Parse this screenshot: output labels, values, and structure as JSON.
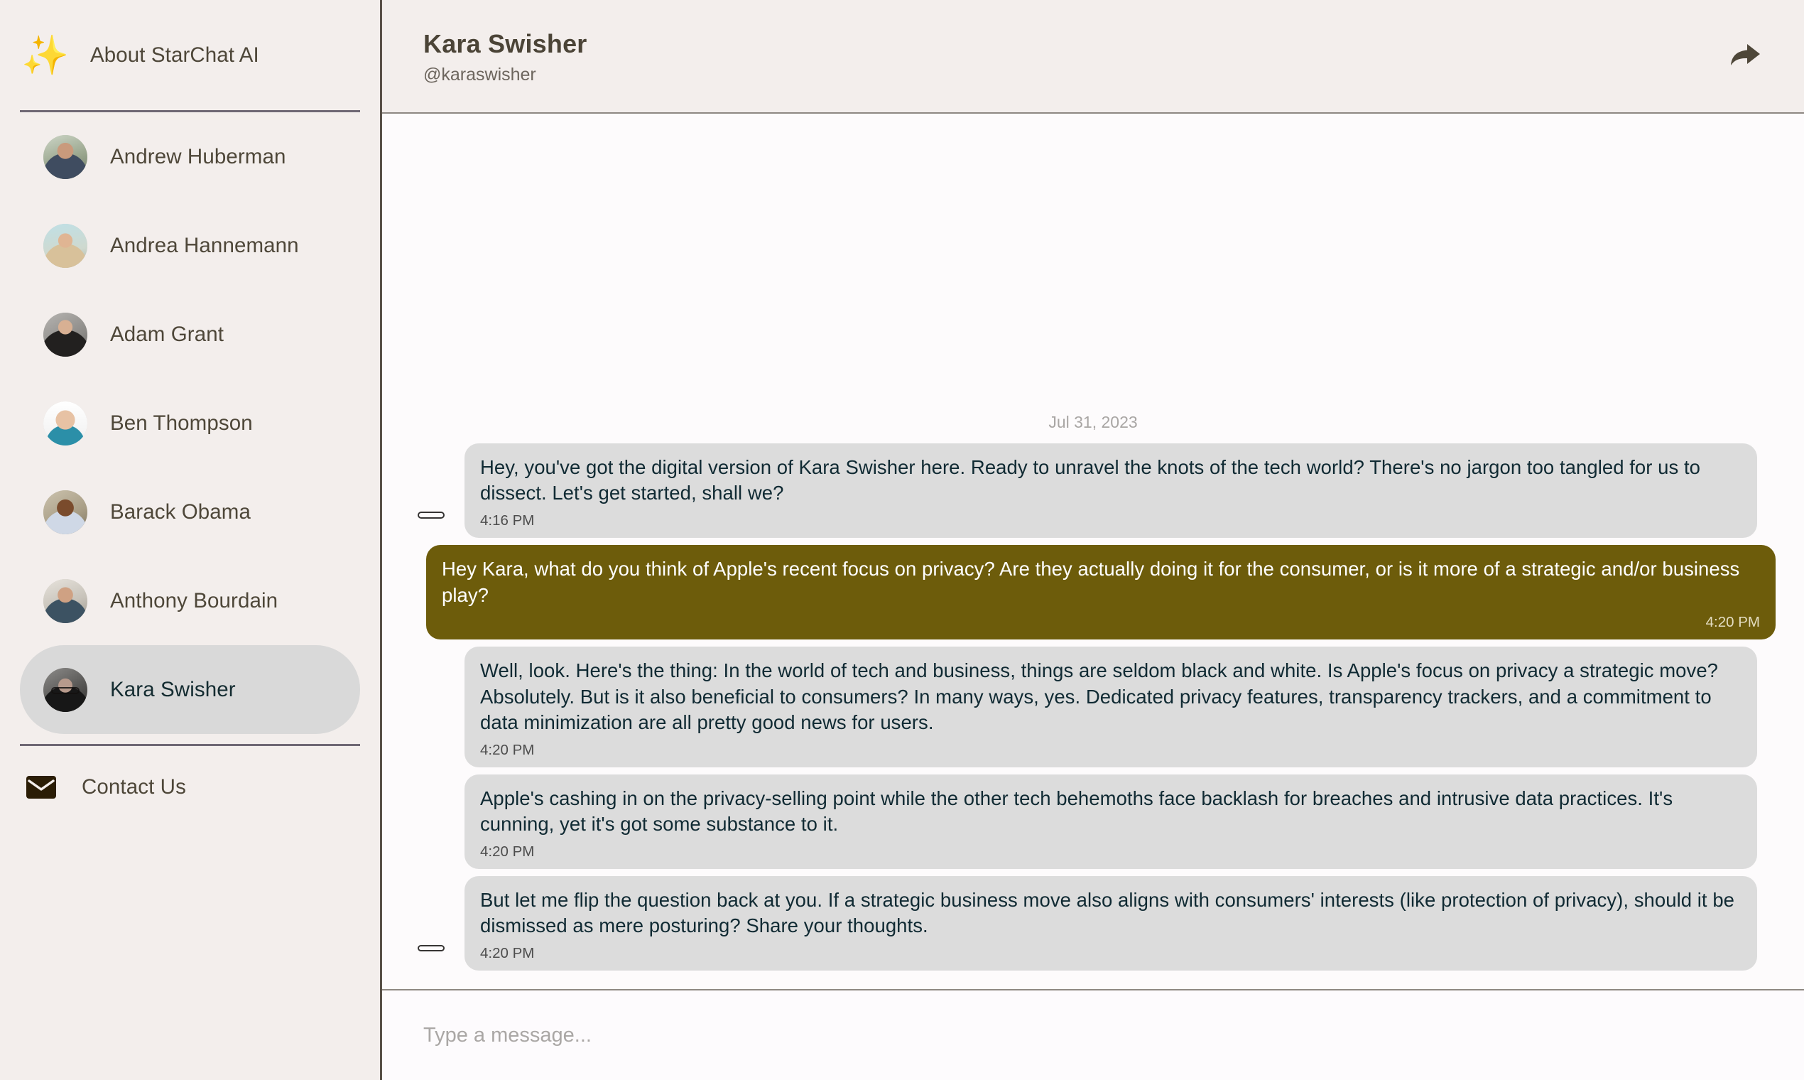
{
  "sidebar": {
    "about": {
      "label": "About StarChat AI",
      "icon": "sparkles-icon"
    },
    "people": [
      {
        "name": "Andrew Huberman",
        "avatar": "av-huberman",
        "selected": false
      },
      {
        "name": "Andrea Hannemann",
        "avatar": "av-hannemann",
        "selected": false
      },
      {
        "name": "Adam Grant",
        "avatar": "av-grant",
        "selected": false
      },
      {
        "name": "Ben Thompson",
        "avatar": "av-thompson",
        "selected": false
      },
      {
        "name": "Barack Obama",
        "avatar": "av-obama",
        "selected": false
      },
      {
        "name": "Anthony Bourdain",
        "avatar": "av-bourdain",
        "selected": false
      },
      {
        "name": "Kara Swisher",
        "avatar": "av-swisher",
        "selected": true
      }
    ],
    "contact": {
      "label": "Contact Us",
      "icon": "envelope-icon"
    }
  },
  "header": {
    "name": "Kara Swisher",
    "handle": "@karaswisher",
    "share_icon": "share-arrow-icon"
  },
  "conversation": {
    "date_separator": "Jul 31, 2023",
    "messages": [
      {
        "direction": "in",
        "text": "Hey, you've got the digital version of Kara Swisher here. Ready to unravel the knots of the tech world? There's no jargon too tangled for us to dissect. Let's get started, shall we?",
        "time": "4:16 PM",
        "show_avatar": true
      },
      {
        "direction": "out",
        "text": "Hey Kara, what do you think of Apple's recent focus on privacy? Are they actually doing it for the consumer, or is it more of a strategic and/or business play?",
        "time": "4:20 PM",
        "show_avatar": false
      },
      {
        "direction": "in",
        "text": "Well, look. Here's the thing: In the world of tech and business, things are seldom black and white. Is Apple's focus on privacy a strategic move? Absolutely. But is it also beneficial to consumers? In many ways, yes. Dedicated privacy features, transparency trackers, and a commitment to data minimization are all pretty good news for users.",
        "time": "4:20 PM",
        "show_avatar": false
      },
      {
        "direction": "in",
        "text": "Apple's cashing in on the privacy-selling point while the other tech behemoths face backlash for breaches and intrusive data practices. It's cunning, yet it's got some substance to it.",
        "time": "4:20 PM",
        "show_avatar": false
      },
      {
        "direction": "in",
        "text": "But let me flip the question back at you. If a strategic business move also aligns with consumers' interests (like protection of privacy), should it be dismissed as mere posturing? Share your thoughts.",
        "time": "4:20 PM",
        "show_avatar": true
      }
    ]
  },
  "composer": {
    "placeholder": "Type a message...",
    "value": ""
  },
  "colors": {
    "sidebar_bg": "#f3eeec",
    "chat_bg": "#fdfbfc",
    "bubble_in": "#dcdcdc",
    "bubble_in_text": "#102a33",
    "bubble_out": "#6d5c0b",
    "bubble_out_text": "#ffffff",
    "selected_pill": "#d9d9d9",
    "sidebar_text": "#4e4739",
    "divider": "#6f6874"
  }
}
